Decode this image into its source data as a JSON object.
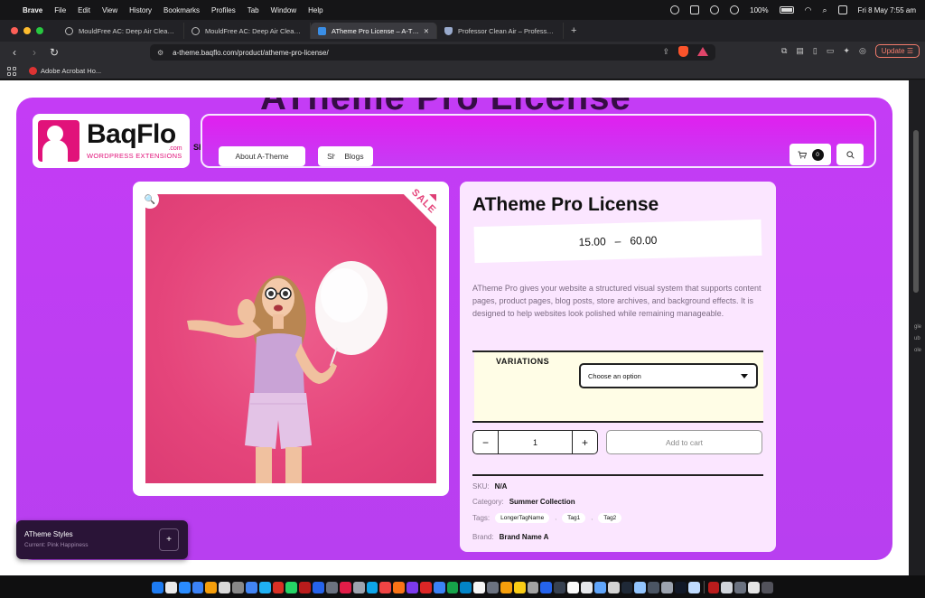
{
  "menubar": {
    "app": "Brave",
    "items": [
      "File",
      "Edit",
      "View",
      "History",
      "Bookmarks",
      "Profiles",
      "Tab",
      "Window",
      "Help"
    ],
    "battery": "100%",
    "datetime": "Fri 8 May  7:55 am"
  },
  "tabs": [
    {
      "label": "MouldFree AC: Deep Air Cleaning",
      "active": false
    },
    {
      "label": "MouldFree AC: Deep Air Cleaning",
      "active": false
    },
    {
      "label": "ATheme Pro License – A-Theme",
      "active": true
    },
    {
      "label": "Professor Clean Air – Professor Cle",
      "active": false
    }
  ],
  "toolbar": {
    "url": "a-theme.baqflo.com/product/atheme-pro-license/",
    "update_label": "Update"
  },
  "bookmarks": [
    {
      "label": "Adobe Acrobat Ho..."
    }
  ],
  "page": {
    "bg_title": "ATheme Pro License",
    "logo": {
      "name": "BaqFlo",
      "domain": ".com",
      "tagline": "WORDPRESS EXTENSIONS",
      "cut": "Sh"
    },
    "nav": [
      "About A-Theme",
      "Shop",
      "Blogs"
    ],
    "cart_count": "0",
    "sale_badge": "SALE",
    "product": {
      "title": "ATheme Pro License",
      "price_min": "15.00",
      "price_sep": "–",
      "price_max": "60.00",
      "description": "ATheme Pro gives your website a structured visual system that supports content pages, product pages, blog posts, store archives, and background effects. It is designed to help websites look polished while remaining manageable.",
      "variations_label": "VARIATIONS",
      "select_placeholder": "Choose an option",
      "quantity": "1",
      "minus": "−",
      "plus": "+",
      "add_to_cart": "Add to cart",
      "sku_label": "SKU:",
      "sku_value": "N/A",
      "category_label": "Category:",
      "category_value": "Summer Collection",
      "tags_label": "Tags:",
      "tags": [
        "LongerTagName",
        "Tag1",
        "Tag2"
      ],
      "brand_label": "Brand:",
      "brand_value": "Brand Name A"
    },
    "styles_panel": {
      "title": "ATheme Styles",
      "subtitle": "Current: Pink Happiness",
      "add": "+"
    }
  },
  "colors": {
    "accent_purple": "#c43cf5",
    "details_bg": "#fbe6ff",
    "brand_pink": "#e1127a",
    "photo_pink": "#e5457b"
  },
  "side_text": [
    "gle",
    "ub",
    "ole"
  ]
}
